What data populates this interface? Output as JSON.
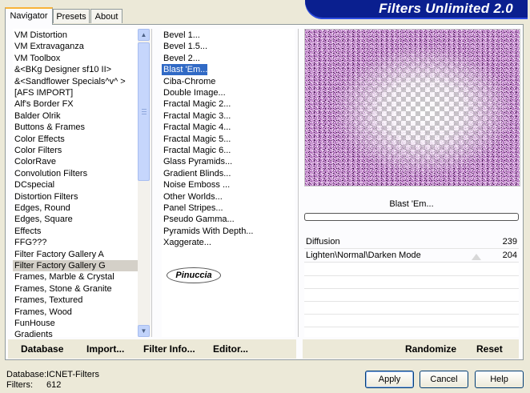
{
  "tabs": [
    {
      "label": "Navigator",
      "active": true
    },
    {
      "label": "Presets",
      "active": false
    },
    {
      "label": "About",
      "active": false
    }
  ],
  "logo_text": "Filters Unlimited 2.0",
  "categories": [
    "VM Distortion",
    "VM Extravaganza",
    "VM Toolbox",
    "&<BKg Designer sf10 II>",
    "&<Sandflower Specials^v^ >",
    "[AFS IMPORT]",
    "Alf's Border FX",
    "Balder Olrik",
    "Buttons & Frames",
    "Color Effects",
    "Color Filters",
    "ColorRave",
    "Convolution Filters",
    "DCspecial",
    "Distortion Filters",
    "Edges, Round",
    "Edges, Square",
    "Effects",
    "FFG???",
    "Filter Factory Gallery A",
    "Filter Factory Gallery G",
    "Frames, Marble & Crystal",
    "Frames, Stone & Granite",
    "Frames, Textured",
    "Frames, Wood",
    "FunHouse",
    "Gradients"
  ],
  "selected_category": "Filter Factory Gallery G",
  "filters": [
    "Bevel 1...",
    "Bevel 1.5...",
    "Bevel 2...",
    "Blast 'Em...",
    "Ciba-Chrome",
    "Double Image...",
    "Fractal Magic 2...",
    "Fractal Magic 3...",
    "Fractal Magic 4...",
    "Fractal Magic 5...",
    "Fractal Magic 6...",
    "Glass Pyramids...",
    "Gradient Blinds...",
    "Noise Emboss ...",
    "Other Worlds...",
    "Panel Stripes...",
    "Pseudo Gamma...",
    "Pyramids With Depth...",
    "Xaggerate..."
  ],
  "selected_filter": "Blast 'Em...",
  "watermark": "Pinuccia",
  "filter_name": "Blast 'Em...",
  "params": [
    {
      "label": "Diffusion",
      "value": "239"
    },
    {
      "label": "Lighten\\Normal\\Darken Mode",
      "value": "204"
    }
  ],
  "left_buttons": [
    "Database",
    "Import...",
    "Filter Info...",
    "Editor..."
  ],
  "right_buttons": [
    "Randomize",
    "Reset"
  ],
  "status": {
    "database_label": "Database:",
    "database_value": "ICNET-Filters",
    "filters_label": "Filters:",
    "filters_value": "612"
  },
  "dialog_buttons": {
    "apply": "Apply",
    "cancel": "Cancel",
    "help": "Help"
  },
  "colors": {
    "logo_bg": "#0a1f8f",
    "selection": "#316ac5",
    "preview_purple": "#b06fbd"
  }
}
